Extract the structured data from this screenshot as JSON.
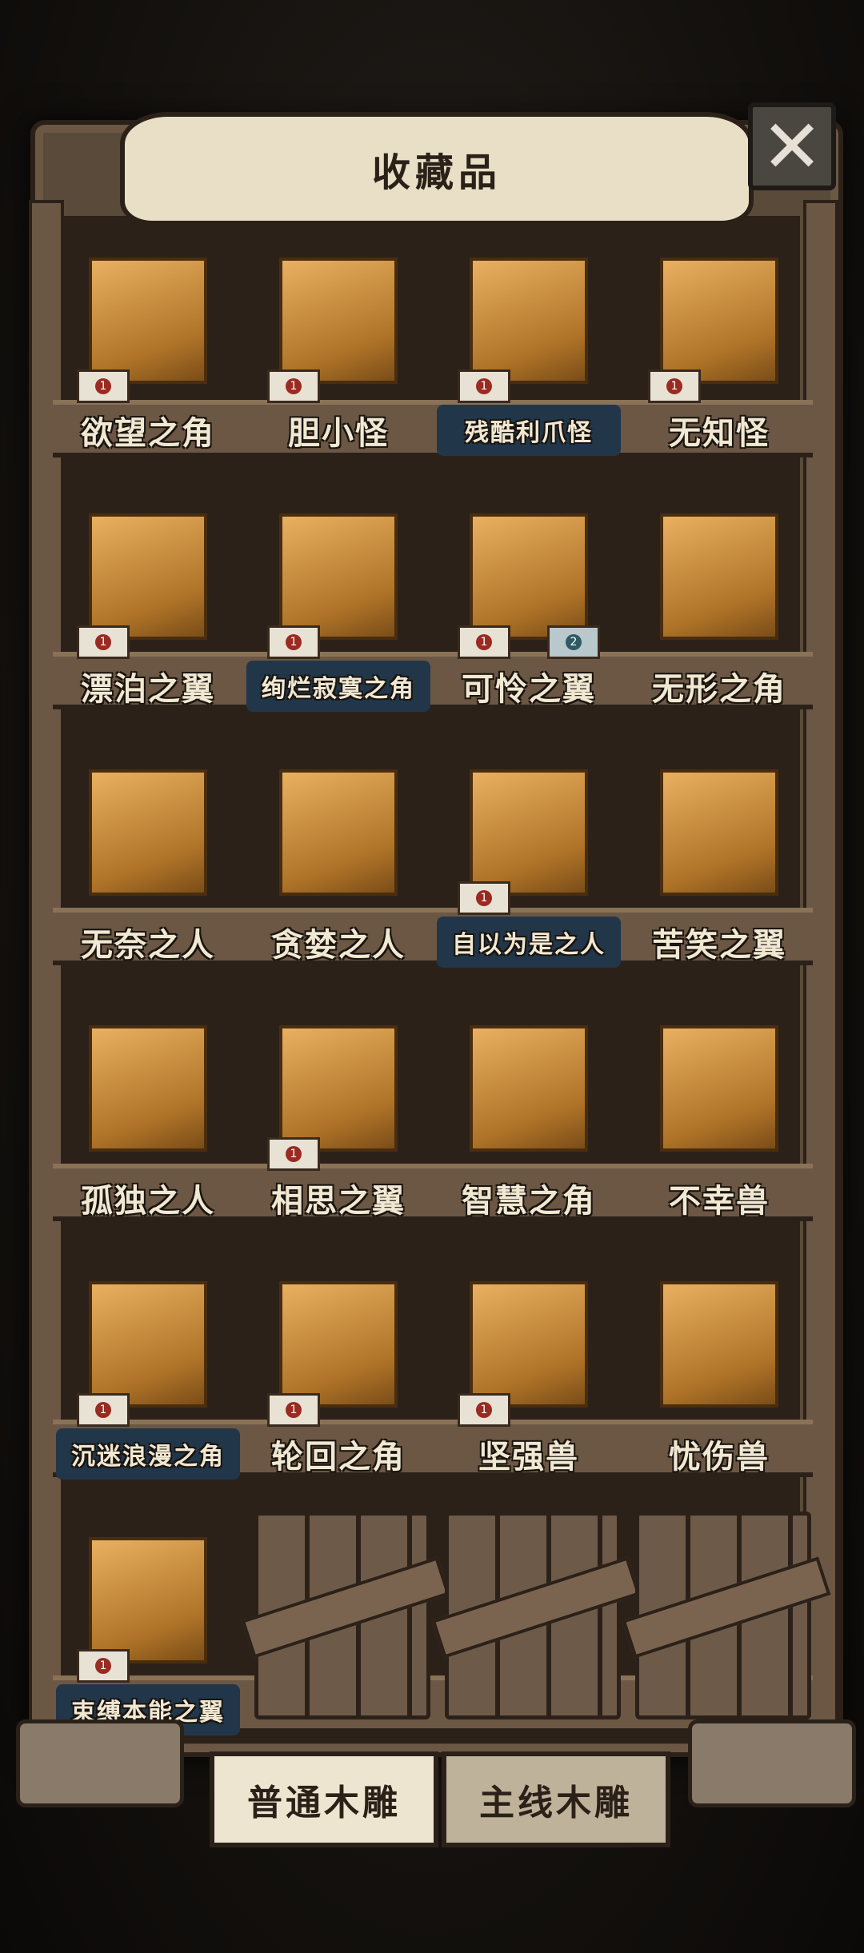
{
  "header": {
    "title": "收藏品",
    "close_icon": "close-x-icon"
  },
  "shelves": [
    {
      "items": [
        {
          "name": "欲望之角",
          "badge": "1",
          "highlight": false
        },
        {
          "name": "胆小怪",
          "badge": "1",
          "highlight": false
        },
        {
          "name": "残酷利爪怪",
          "badge": "1",
          "highlight": true
        },
        {
          "name": "无知怪",
          "badge": "1",
          "highlight": false
        }
      ]
    },
    {
      "items": [
        {
          "name": "漂泊之翼",
          "badge": "1",
          "highlight": false
        },
        {
          "name": "绚烂寂寞之角",
          "badge": "1",
          "highlight": true
        },
        {
          "name": "可怜之翼",
          "badge": "1",
          "badge2": "2",
          "highlight": false
        },
        {
          "name": "无形之角",
          "highlight": false
        }
      ]
    },
    {
      "items": [
        {
          "name": "无奈之人",
          "highlight": false
        },
        {
          "name": "贪婪之人",
          "highlight": false
        },
        {
          "name": "自以为是之人",
          "badge": "1",
          "highlight": true
        },
        {
          "name": "苦笑之翼",
          "highlight": false
        }
      ]
    },
    {
      "items": [
        {
          "name": "孤独之人",
          "highlight": false
        },
        {
          "name": "相思之翼",
          "badge": "1",
          "highlight": false
        },
        {
          "name": "智慧之角",
          "highlight": false
        },
        {
          "name": "不幸兽",
          "highlight": false
        }
      ]
    },
    {
      "items": [
        {
          "name": "沉迷浪漫之角",
          "badge": "1",
          "highlight": true
        },
        {
          "name": "轮回之角",
          "badge": "1",
          "highlight": false
        },
        {
          "name": "坚强兽",
          "badge": "1",
          "highlight": false
        },
        {
          "name": "忧伤兽",
          "highlight": false
        }
      ]
    },
    {
      "items": [
        {
          "name": "束缚本能之翼",
          "badge": "1",
          "highlight": true
        },
        {
          "locked": true
        },
        {
          "locked": true
        },
        {
          "locked": true
        }
      ]
    }
  ],
  "tabs": {
    "normal": "普通木雕",
    "main": "主线木雕"
  }
}
